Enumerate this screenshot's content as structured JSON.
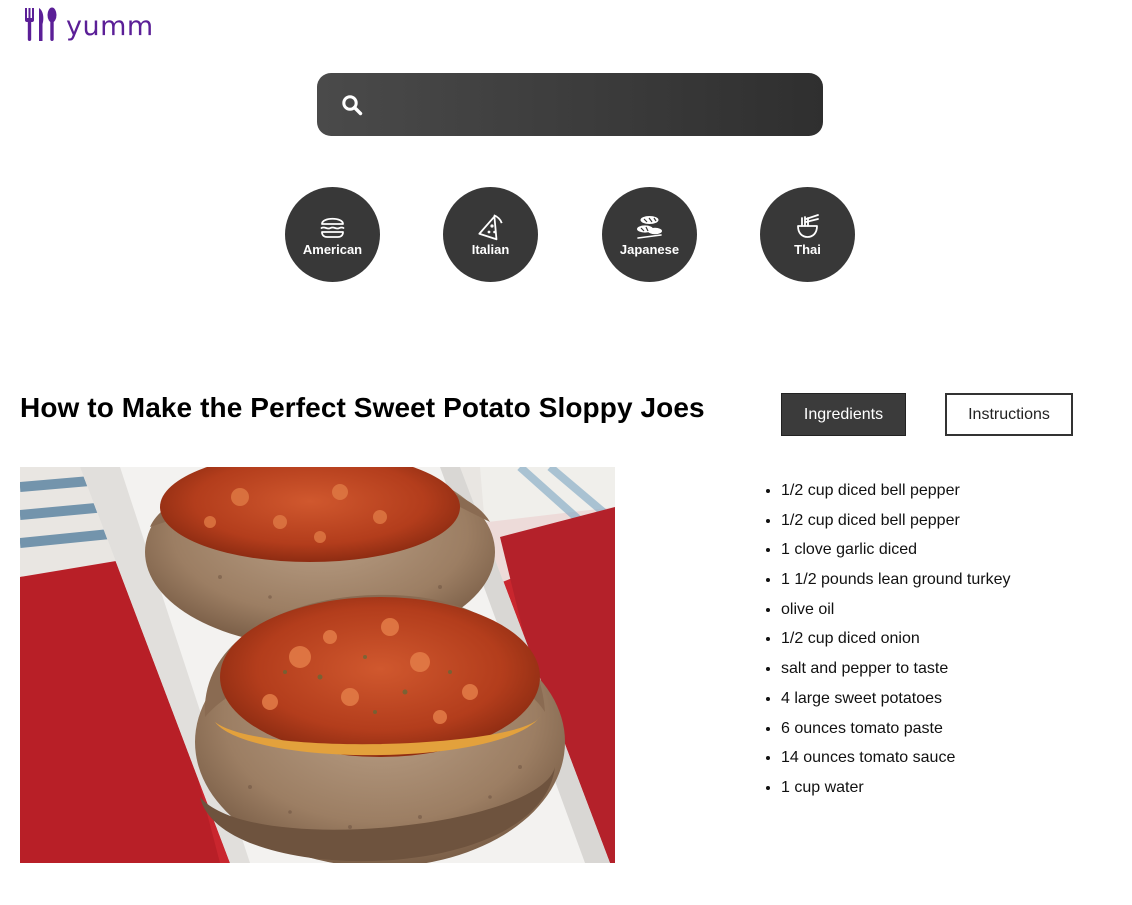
{
  "brand": {
    "name": "yumm",
    "color": "#5b1f97",
    "icon": "fork-knife-spoon-icon"
  },
  "search": {
    "value": "",
    "placeholder": "",
    "icon": "search-icon"
  },
  "cuisines": [
    {
      "label": "American",
      "icon": "burger-icon"
    },
    {
      "label": "Italian",
      "icon": "pizza-slice-icon"
    },
    {
      "label": "Japanese",
      "icon": "sushi-icon"
    },
    {
      "label": "Thai",
      "icon": "noodle-bowl-icon"
    }
  ],
  "recipe": {
    "title": "How to Make the Perfect Sweet Potato Sloppy Joes",
    "tabs": {
      "ingredients": "Ingredients",
      "instructions": "Instructions",
      "active": "ingredients"
    },
    "ingredients": [
      "1/2 cup diced bell pepper",
      "1/2 cup diced bell pepper",
      "1 clove garlic diced",
      "1 1/2 pounds lean ground turkey",
      "olive oil",
      "1/2 cup diced onion",
      "salt and pepper to taste",
      "4 large sweet potatoes",
      "6 ounces tomato paste",
      "14 ounces tomato sauce",
      "1 cup water"
    ]
  },
  "colors": {
    "dark_ui": "#383838",
    "accent": "#5b1f97"
  }
}
